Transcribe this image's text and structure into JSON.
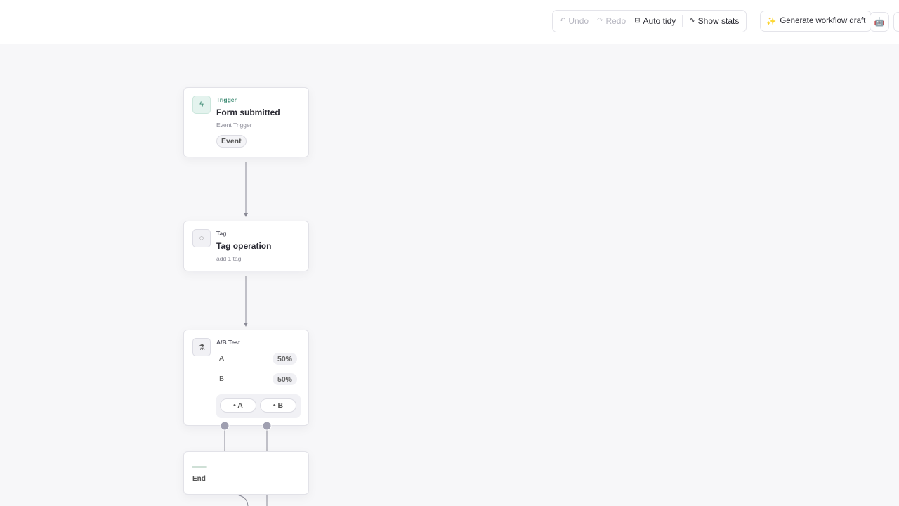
{
  "toolbar": {
    "undo": "Undo",
    "redo": "Redo",
    "auto_tidy": "Auto tidy",
    "show_stats": "Show stats",
    "generate": "Generate workflow draft"
  },
  "nodes": {
    "trigger": {
      "type": "Trigger",
      "title": "Form submitted",
      "subtitle": "Event Trigger",
      "pill": "Event"
    },
    "tag": {
      "type": "Tag",
      "title": "Tag operation",
      "subtitle": "add 1 tag"
    },
    "ab": {
      "type": "A/B Test",
      "rows": [
        {
          "label": "A",
          "pct": "50%"
        },
        {
          "label": "B",
          "pct": "50%"
        }
      ],
      "branch_a": "• A",
      "branch_b": "• B"
    },
    "end": {
      "label": "End"
    }
  },
  "colors": {
    "trigger_accent": "#3b8a72",
    "edge": "#8a8a96",
    "handle": "#9f9fb0"
  }
}
